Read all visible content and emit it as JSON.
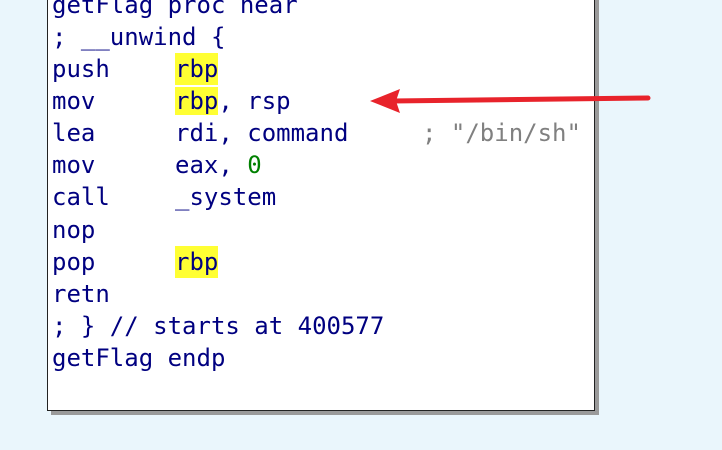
{
  "proc_header": "getFlag proc near",
  "unwind_open": "; __unwind {",
  "instructions": [
    {
      "mnemonic": "push",
      "operand": "rbp"
    },
    {
      "mnemonic": "mov",
      "operand_hl": "rbp",
      "operand_rest": ", rsp"
    },
    {
      "mnemonic": "lea",
      "operand": "rdi, command",
      "comment": "; \"/bin/sh\""
    },
    {
      "mnemonic": "mov",
      "operand_prefix": "eax, ",
      "operand_num": "0"
    },
    {
      "mnemonic": "call",
      "operand": "_system"
    },
    {
      "mnemonic": "nop"
    },
    {
      "mnemonic": "pop",
      "operand": "rbp"
    },
    {
      "mnemonic": "retn"
    }
  ],
  "unwind_close": "; } // starts at 400577",
  "proc_footer": "getFlag endp",
  "colors": {
    "background": "#eaf6fc",
    "code_text": "#000080",
    "register_highlight": "#ffff33",
    "immediate_value": "#008000",
    "comment_text": "#808080",
    "arrow": "#e8232b"
  }
}
